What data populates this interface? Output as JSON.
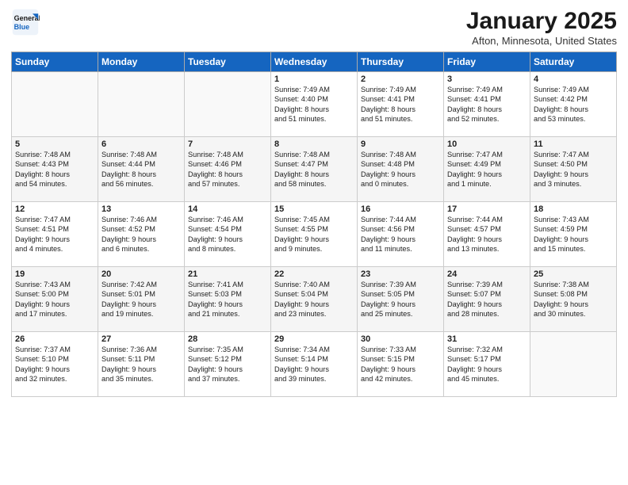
{
  "header": {
    "logo_line1": "General",
    "logo_line2": "Blue",
    "title": "January 2025",
    "subtitle": "Afton, Minnesota, United States"
  },
  "days_of_week": [
    "Sunday",
    "Monday",
    "Tuesday",
    "Wednesday",
    "Thursday",
    "Friday",
    "Saturday"
  ],
  "weeks": [
    [
      {
        "num": "",
        "detail": ""
      },
      {
        "num": "",
        "detail": ""
      },
      {
        "num": "",
        "detail": ""
      },
      {
        "num": "1",
        "detail": "Sunrise: 7:49 AM\nSunset: 4:40 PM\nDaylight: 8 hours\nand 51 minutes."
      },
      {
        "num": "2",
        "detail": "Sunrise: 7:49 AM\nSunset: 4:41 PM\nDaylight: 8 hours\nand 51 minutes."
      },
      {
        "num": "3",
        "detail": "Sunrise: 7:49 AM\nSunset: 4:41 PM\nDaylight: 8 hours\nand 52 minutes."
      },
      {
        "num": "4",
        "detail": "Sunrise: 7:49 AM\nSunset: 4:42 PM\nDaylight: 8 hours\nand 53 minutes."
      }
    ],
    [
      {
        "num": "5",
        "detail": "Sunrise: 7:48 AM\nSunset: 4:43 PM\nDaylight: 8 hours\nand 54 minutes."
      },
      {
        "num": "6",
        "detail": "Sunrise: 7:48 AM\nSunset: 4:44 PM\nDaylight: 8 hours\nand 56 minutes."
      },
      {
        "num": "7",
        "detail": "Sunrise: 7:48 AM\nSunset: 4:46 PM\nDaylight: 8 hours\nand 57 minutes."
      },
      {
        "num": "8",
        "detail": "Sunrise: 7:48 AM\nSunset: 4:47 PM\nDaylight: 8 hours\nand 58 minutes."
      },
      {
        "num": "9",
        "detail": "Sunrise: 7:48 AM\nSunset: 4:48 PM\nDaylight: 9 hours\nand 0 minutes."
      },
      {
        "num": "10",
        "detail": "Sunrise: 7:47 AM\nSunset: 4:49 PM\nDaylight: 9 hours\nand 1 minute."
      },
      {
        "num": "11",
        "detail": "Sunrise: 7:47 AM\nSunset: 4:50 PM\nDaylight: 9 hours\nand 3 minutes."
      }
    ],
    [
      {
        "num": "12",
        "detail": "Sunrise: 7:47 AM\nSunset: 4:51 PM\nDaylight: 9 hours\nand 4 minutes."
      },
      {
        "num": "13",
        "detail": "Sunrise: 7:46 AM\nSunset: 4:52 PM\nDaylight: 9 hours\nand 6 minutes."
      },
      {
        "num": "14",
        "detail": "Sunrise: 7:46 AM\nSunset: 4:54 PM\nDaylight: 9 hours\nand 8 minutes."
      },
      {
        "num": "15",
        "detail": "Sunrise: 7:45 AM\nSunset: 4:55 PM\nDaylight: 9 hours\nand 9 minutes."
      },
      {
        "num": "16",
        "detail": "Sunrise: 7:44 AM\nSunset: 4:56 PM\nDaylight: 9 hours\nand 11 minutes."
      },
      {
        "num": "17",
        "detail": "Sunrise: 7:44 AM\nSunset: 4:57 PM\nDaylight: 9 hours\nand 13 minutes."
      },
      {
        "num": "18",
        "detail": "Sunrise: 7:43 AM\nSunset: 4:59 PM\nDaylight: 9 hours\nand 15 minutes."
      }
    ],
    [
      {
        "num": "19",
        "detail": "Sunrise: 7:43 AM\nSunset: 5:00 PM\nDaylight: 9 hours\nand 17 minutes."
      },
      {
        "num": "20",
        "detail": "Sunrise: 7:42 AM\nSunset: 5:01 PM\nDaylight: 9 hours\nand 19 minutes."
      },
      {
        "num": "21",
        "detail": "Sunrise: 7:41 AM\nSunset: 5:03 PM\nDaylight: 9 hours\nand 21 minutes."
      },
      {
        "num": "22",
        "detail": "Sunrise: 7:40 AM\nSunset: 5:04 PM\nDaylight: 9 hours\nand 23 minutes."
      },
      {
        "num": "23",
        "detail": "Sunrise: 7:39 AM\nSunset: 5:05 PM\nDaylight: 9 hours\nand 25 minutes."
      },
      {
        "num": "24",
        "detail": "Sunrise: 7:39 AM\nSunset: 5:07 PM\nDaylight: 9 hours\nand 28 minutes."
      },
      {
        "num": "25",
        "detail": "Sunrise: 7:38 AM\nSunset: 5:08 PM\nDaylight: 9 hours\nand 30 minutes."
      }
    ],
    [
      {
        "num": "26",
        "detail": "Sunrise: 7:37 AM\nSunset: 5:10 PM\nDaylight: 9 hours\nand 32 minutes."
      },
      {
        "num": "27",
        "detail": "Sunrise: 7:36 AM\nSunset: 5:11 PM\nDaylight: 9 hours\nand 35 minutes."
      },
      {
        "num": "28",
        "detail": "Sunrise: 7:35 AM\nSunset: 5:12 PM\nDaylight: 9 hours\nand 37 minutes."
      },
      {
        "num": "29",
        "detail": "Sunrise: 7:34 AM\nSunset: 5:14 PM\nDaylight: 9 hours\nand 39 minutes."
      },
      {
        "num": "30",
        "detail": "Sunrise: 7:33 AM\nSunset: 5:15 PM\nDaylight: 9 hours\nand 42 minutes."
      },
      {
        "num": "31",
        "detail": "Sunrise: 7:32 AM\nSunset: 5:17 PM\nDaylight: 9 hours\nand 45 minutes."
      },
      {
        "num": "",
        "detail": ""
      }
    ]
  ]
}
